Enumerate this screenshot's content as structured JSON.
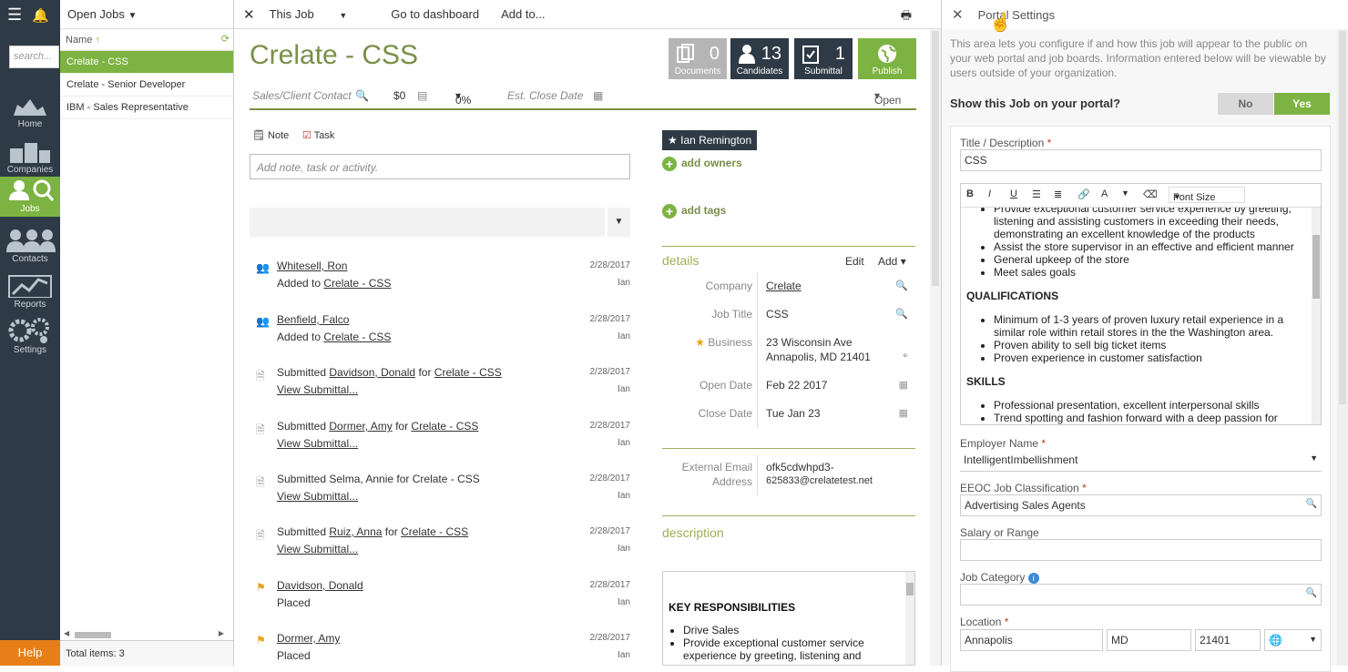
{
  "nav": {
    "help": "Help",
    "search_placeholder": "search...",
    "items": [
      {
        "label": "Home",
        "icon": "home-icon"
      },
      {
        "label": "Companies",
        "icon": "building-icon"
      },
      {
        "label": "Jobs",
        "icon": "jobs-icon"
      },
      {
        "label": "Contacts",
        "icon": "contacts-icon"
      },
      {
        "label": "Reports",
        "icon": "reports-icon"
      },
      {
        "label": "Settings",
        "icon": "settings-icon"
      }
    ]
  },
  "jobs": {
    "header": "Open Jobs",
    "col": "Name",
    "rows": [
      "Crelate - CSS",
      "Crelate - Senior Developer",
      "IBM - Sales Representative"
    ],
    "footer": "Total items: 3"
  },
  "toolbar": {
    "this_job": "This Job",
    "dashboard": "Go to dashboard",
    "add_to": "Add to..."
  },
  "job": {
    "title": "Crelate - CSS",
    "contact_placeholder": "Sales/Client Contact",
    "value": "$0",
    "percent": "0%",
    "close_placeholder": "Est. Close Date",
    "status": "Open"
  },
  "stats": [
    {
      "num": "0",
      "label": "Documents"
    },
    {
      "num": "13",
      "label": "Candidates"
    },
    {
      "num": "1",
      "label": "Submittal"
    },
    {
      "num": "",
      "label": "Publish"
    }
  ],
  "note": {
    "note": "Note",
    "task": "Task",
    "placeholder": "Add note, task or activity."
  },
  "activities": [
    {
      "l1a": "Whitesell, Ron",
      "l2a": "Added to ",
      "l2b": "Crelate - CSS",
      "date": "2/28/2017",
      "user": "Ian"
    },
    {
      "l1a": "Benfield, Falco",
      "l2a": "Added to ",
      "l2b": "Crelate - CSS",
      "date": "2/28/2017",
      "user": "Ian"
    },
    {
      "l1pre": "Submitted ",
      "l1a": "Davidson, Donald",
      "l1mid": " for ",
      "l1b": "Crelate - CSS",
      "l2link": "View Submittal...",
      "date": "2/28/2017",
      "user": "Ian"
    },
    {
      "l1pre": "Submitted ",
      "l1a": "Dormer, Amy",
      "l1mid": " for ",
      "l1b": "Crelate - CSS",
      "l2link": "View Submittal...",
      "date": "2/28/2017",
      "user": "Ian"
    },
    {
      "l1plain": "Submitted Selma, Annie for Crelate - CSS",
      "l2link": "View Submittal...",
      "date": "2/28/2017",
      "user": "Ian"
    },
    {
      "l1pre": "Submitted ",
      "l1a": "Ruiz, Anna",
      "l1mid": " for ",
      "l1b": "Crelate - CSS",
      "l2link": "View Submittal...",
      "date": "2/28/2017",
      "user": "Ian"
    },
    {
      "l1a": "Davidson, Donald",
      "l2plain": "Placed",
      "date": "2/28/2017",
      "user": "Ian"
    },
    {
      "l1a": "Dormer, Amy",
      "l2plain": "Placed",
      "date": "2/28/2017",
      "user": "Ian"
    }
  ],
  "owners": {
    "owner": "Ian Remington",
    "add_owners": "add owners",
    "add_tags": "add tags"
  },
  "details": {
    "heading": "details",
    "edit": "Edit",
    "add": "Add",
    "company_k": "Company",
    "company_v": "Crelate",
    "title_k": "Job Title",
    "title_v": "CSS",
    "business_k": "Business",
    "addr1": "23 Wisconsin Ave",
    "addr2": "Annapolis, MD 21401",
    "open_k": "Open Date",
    "open_v": "Feb 22 2017",
    "close_k": "Close Date",
    "close_v": "Tue Jan 23",
    "email_k1": "External Email",
    "email_k2": "Address",
    "email_v1": "ofk5cdwhpd3-",
    "email_v2": "625833@crelatetest.net"
  },
  "description": {
    "heading": "description",
    "h": "KEY RESPONSIBILITIES",
    "items": [
      "Drive Sales",
      "Provide exceptional customer service experience by greeting, listening and"
    ]
  },
  "panel": {
    "title": "Portal Settings",
    "intro": "This area lets you configure if and how this job will appear to the public on your web portal and job boards. Information entered below will be viewable by users outside of your organization.",
    "show_q": "Show this Job on your portal?",
    "no": "No",
    "yes": "Yes",
    "title_label": "Title / Description",
    "title_value": "CSS",
    "font_size": "Font Size",
    "rte": {
      "resp": [
        "Provide exceptional customer service experience by greeting, listening and assisting customers in exceeding their needs, demonstrating an excellent knowledge of the products",
        "Assist the store supervisor in an effective and efficient manner",
        "General upkeep of the store",
        "Meet sales goals"
      ],
      "qual_h": "QUALIFICATIONS",
      "qual": [
        "Minimum of 1-3 years of proven luxury retail experience in a similar role within retail stores in the the Washington area.",
        "Proven ability to sell big ticket items",
        "Proven experience in customer satisfaction"
      ],
      "skills_h": "SKILLS",
      "skills": [
        "Professional presentation, excellent interpersonal skills",
        "Trend spotting and fashion forward with a deep passion for"
      ]
    },
    "employer_label": "Employer Name",
    "employer_value": "IntelligentImbellishment",
    "eeoc_label": "EEOC Job Classification",
    "eeoc_value": "Advertising Sales Agents",
    "salary_label": "Salary or Range",
    "category_label": "Job Category",
    "location_label": "Location",
    "city": "Annapolis",
    "state": "MD",
    "zip": "21401"
  }
}
